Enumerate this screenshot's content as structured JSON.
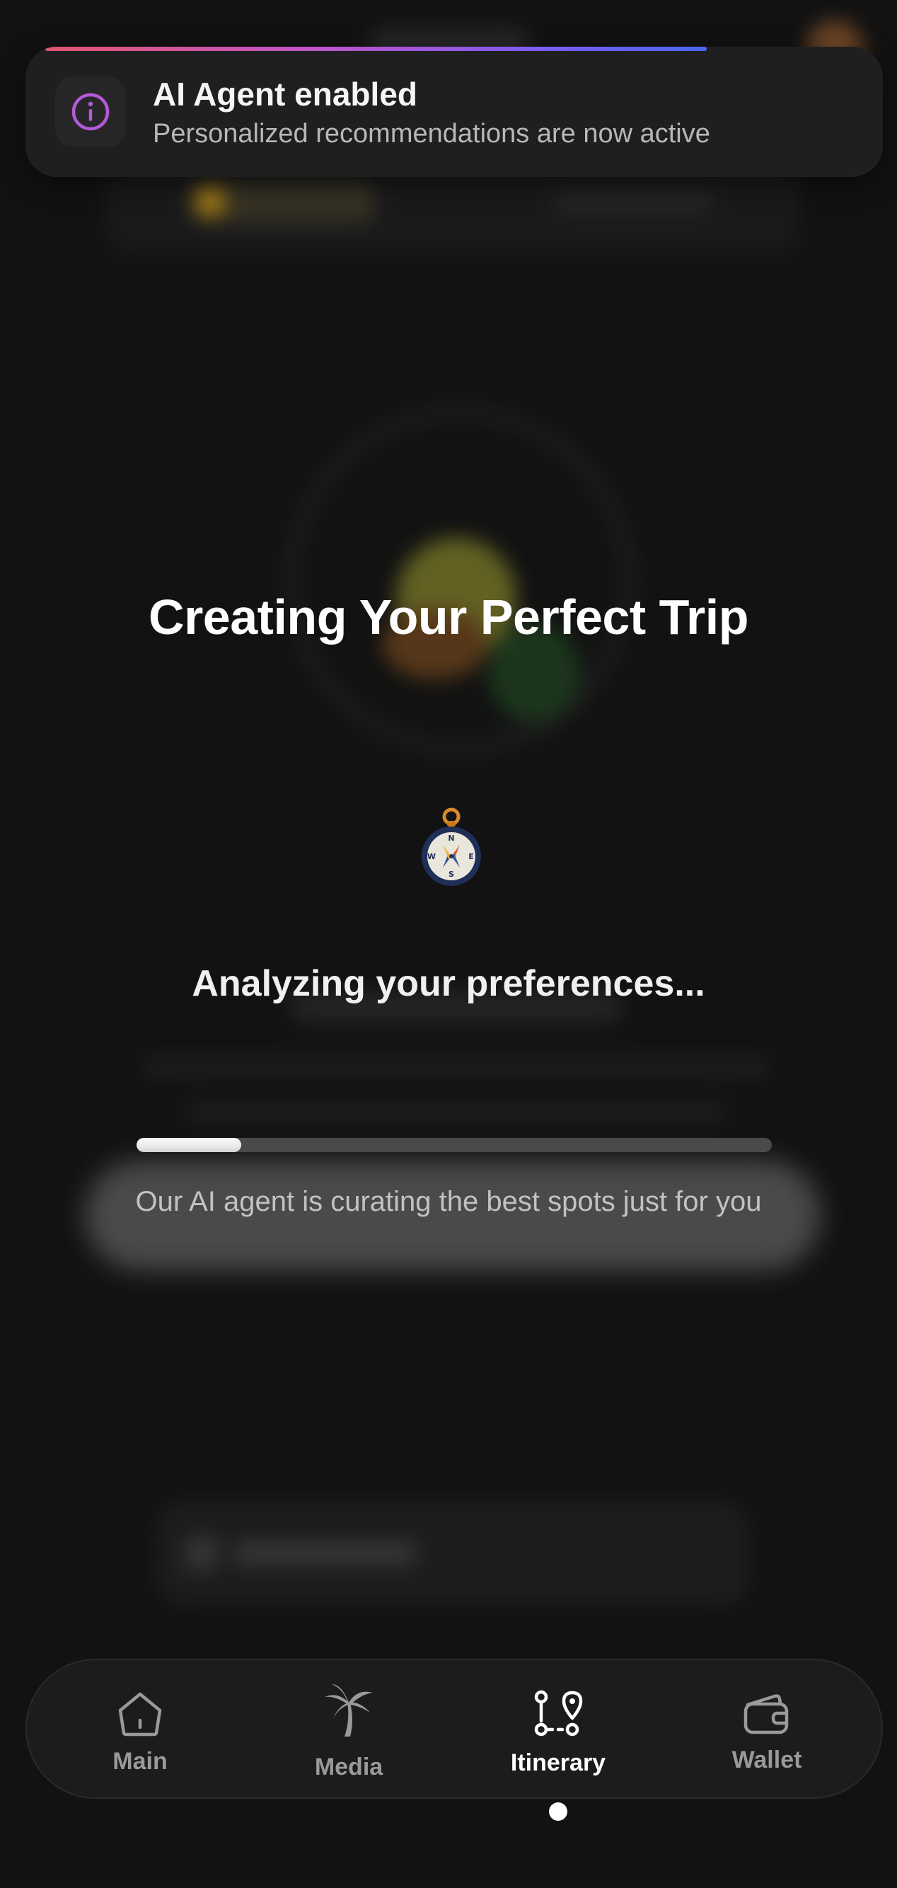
{
  "toast": {
    "title": "AI Agent enabled",
    "subtitle": "Personalized recommendations are now active",
    "icon": "info-icon",
    "accent_gradient": [
      "#e0566f",
      "#c055c8",
      "#7c5cf0",
      "#4a68f0"
    ]
  },
  "loading": {
    "title": "Creating Your Perfect Trip",
    "icon": "compass-icon",
    "status": "Analyzing your preferences...",
    "progress_percent": 16.5,
    "hint": "Our AI agent is curating the best spots just for you"
  },
  "bottom_nav": {
    "items": [
      {
        "label": "Main",
        "icon": "home-icon",
        "active": false
      },
      {
        "label": "Media",
        "icon": "palm-tree-icon",
        "active": false
      },
      {
        "label": "Itinerary",
        "icon": "route-icon",
        "active": true
      },
      {
        "label": "Wallet",
        "icon": "wallet-icon",
        "active": false
      }
    ]
  },
  "colors": {
    "background": "#121212",
    "toast_bg": "#1f1f21",
    "info_icon": "#b35ad8",
    "progress_fill": "#ffffff",
    "progress_track": "#4a4a4c"
  }
}
